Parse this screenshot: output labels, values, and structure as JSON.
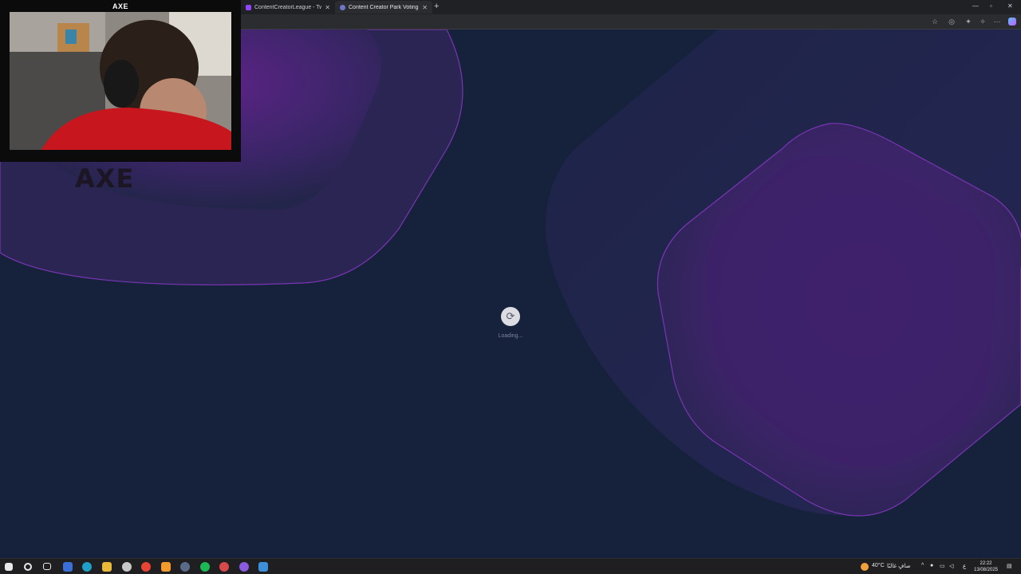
{
  "browser": {
    "tabs": [
      {
        "label": "ContentCreatorLeague - Tw",
        "active": false
      },
      {
        "label": "Content Creator Park Voting - Vo",
        "active": true
      }
    ],
    "new_tab_icon": "plus-icon",
    "window_controls": [
      "minimize-icon",
      "restore-icon",
      "close-icon"
    ]
  },
  "page": {
    "loading_text": "Loading...",
    "loader_icon": "refresh-icon",
    "colors": {
      "background": "#16213c",
      "accent": "#6a2a9a"
    }
  },
  "webcam": {
    "title": "AXE",
    "logo": "AXE"
  },
  "taskbar": {
    "weather": "40°C",
    "weather_text": "صافٍ غالبًا",
    "lang": "ع",
    "time": "22:22",
    "date": "13/08/2025"
  }
}
